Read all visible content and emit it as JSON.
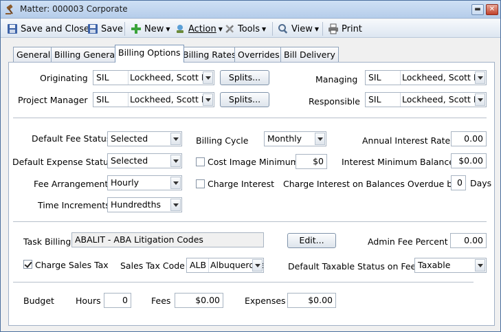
{
  "window": {
    "title": "Matter: 000003 Corporate"
  },
  "toolbar": {
    "save_close": "Save and Close",
    "save": "Save",
    "new": "New",
    "action": "Action",
    "tools": "Tools",
    "view": "View",
    "print": "Print"
  },
  "tabs": [
    "General",
    "Billing General",
    "Billing Options",
    "Billing Rates",
    "Overrides",
    "Bill Delivery"
  ],
  "active_tab": "Billing Options",
  "attorneys": {
    "originating": {
      "label": "Originating",
      "code": "SIL",
      "name": "Lockheed, Scott I."
    },
    "project_manager": {
      "label": "Project Manager",
      "code": "SIL",
      "name": "Lockheed, Scott I."
    },
    "managing": {
      "label": "Managing",
      "code": "SIL",
      "name": "Lockheed, Scott I."
    },
    "responsible": {
      "label": "Responsible",
      "code": "SIL",
      "name": "Lockheed, Scott I."
    },
    "splits_label": "Splits..."
  },
  "billing": {
    "default_fee_status": {
      "label": "Default Fee Status",
      "value": "Selected"
    },
    "default_expense_status": {
      "label": "Default Expense Status",
      "value": "Selected"
    },
    "fee_arrangement": {
      "label": "Fee Arrangement",
      "value": "Hourly"
    },
    "time_increments": {
      "label": "Time Increments",
      "value": "Hundredths"
    },
    "billing_cycle": {
      "label": "Billing Cycle",
      "value": "Monthly"
    },
    "cost_image_minimum": {
      "label": "Cost Image Minimum",
      "value": "$0",
      "checked": false
    },
    "charge_interest": {
      "label": "Charge Interest",
      "checked": false
    },
    "annual_interest_rate": {
      "label": "Annual Interest Rate",
      "value": "0.00"
    },
    "interest_minimum_balance": {
      "label": "Interest Minimum Balance",
      "value": "$0.00"
    },
    "charge_interest_overdue": {
      "label": "Charge Interest on Balances Overdue by",
      "value": "0",
      "unit": "Days"
    }
  },
  "task": {
    "task_billing": {
      "label": "Task Billing",
      "value": "ABALIT - ABA Litigation Codes"
    },
    "edit_label": "Edit...",
    "admin_fee_percent": {
      "label": "Admin Fee Percent",
      "value": "0.00"
    },
    "charge_sales_tax": {
      "label": "Charge Sales Tax",
      "checked": true
    },
    "sales_tax_code": {
      "label": "Sales Tax Code",
      "code": "ALB",
      "name": "Albuquerque"
    },
    "default_taxable_status": {
      "label": "Default Taxable Status on Fees",
      "value": "Taxable"
    }
  },
  "budget": {
    "label": "Budget",
    "hours": {
      "label": "Hours",
      "value": "0"
    },
    "fees": {
      "label": "Fees",
      "value": "$0.00"
    },
    "expenses": {
      "label": "Expenses",
      "value": "$0.00"
    }
  }
}
